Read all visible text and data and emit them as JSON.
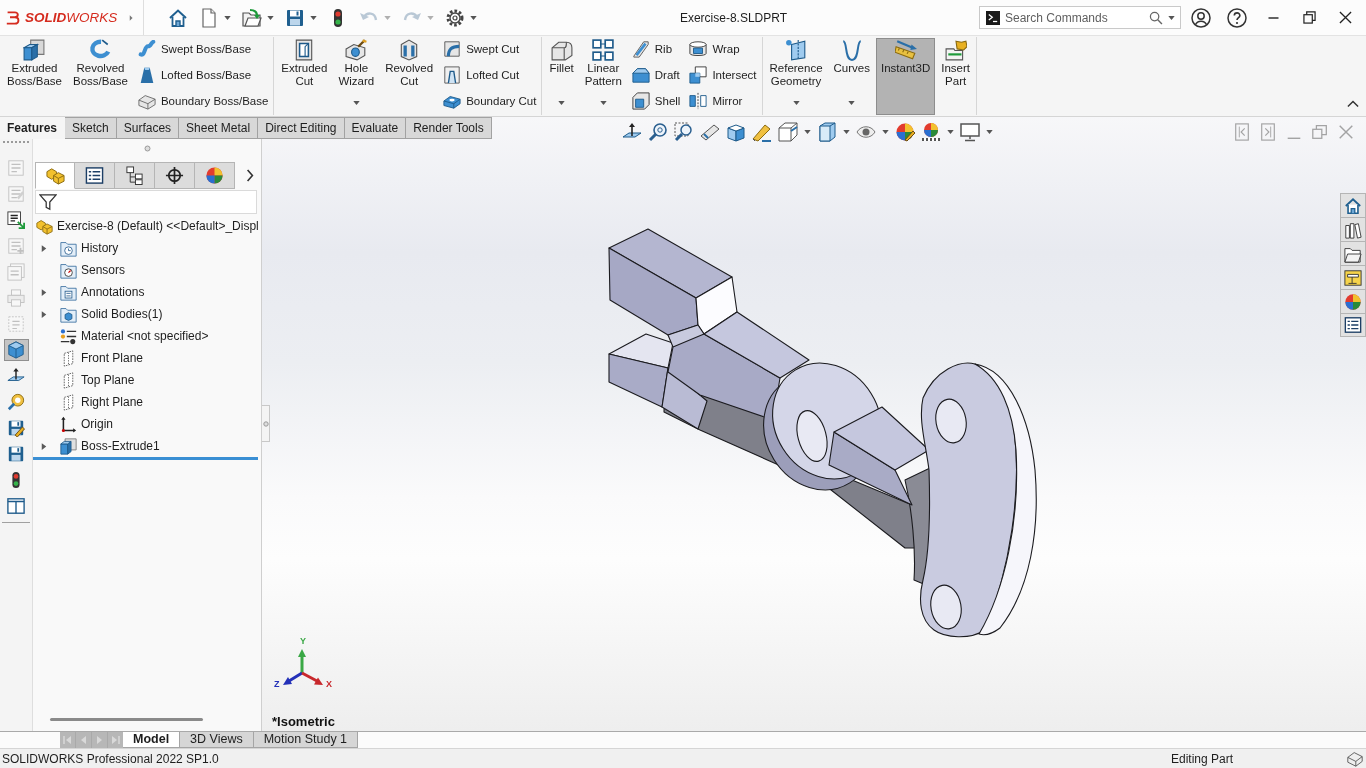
{
  "title_bar": {
    "logo": "**SOLID**WORKS",
    "title": "Exercise-8.SLDPRT",
    "search": {
      "placeholder": "Search Commands"
    }
  },
  "quick_access": [
    {
      "disabled": false,
      "dropdown": false
    },
    {
      "disabled": false,
      "dropdown": true
    },
    {
      "disabled": false,
      "dropdown": true
    },
    {
      "disabled": false,
      "dropdown": true
    },
    {
      "disabled": false,
      "dropdown": false
    },
    {
      "disabled": true,
      "dropdown": true
    },
    {
      "disabled": true,
      "dropdown": true
    },
    {
      "disabled": false,
      "dropdown": true
    }
  ],
  "ribbon": {
    "groups": [
      {
        "columns": [
          {
            "kind": "large",
            "label": "Extruded Boss/Base",
            "dropdown": false,
            "pressed": false
          },
          {
            "kind": "large",
            "label": "Revolved Boss/Base",
            "dropdown": false,
            "pressed": false
          },
          {
            "kind": "small",
            "items": [
              {
                "label": "Swept Boss/Base",
                "pressed": false
              },
              {
                "label": "Lofted Boss/Base",
                "pressed": false
              },
              {
                "label": "Boundary Boss/Base",
                "pressed": false
              }
            ]
          }
        ]
      },
      {
        "columns": [
          {
            "kind": "large",
            "label": "Extruded Cut",
            "dropdown": false,
            "pressed": false
          },
          {
            "kind": "large",
            "label": "Hole Wizard",
            "dropdown": true,
            "pressed": false
          },
          {
            "kind": "large",
            "label": "Revolved Cut",
            "dropdown": false,
            "pressed": false
          },
          {
            "kind": "small",
            "items": [
              {
                "label": "Swept Cut",
                "pressed": false
              },
              {
                "label": "Lofted Cut",
                "pressed": false
              },
              {
                "label": "Boundary Cut",
                "pressed": false
              }
            ]
          }
        ]
      },
      {
        "columns": [
          {
            "kind": "large",
            "label": "Fillet",
            "dropdown": true,
            "pressed": false
          },
          {
            "kind": "large",
            "label": "Linear Pattern",
            "dropdown": true,
            "pressed": false
          },
          {
            "kind": "small",
            "items": [
              {
                "label": "Rib",
                "pressed": false
              },
              {
                "label": "Draft",
                "pressed": false
              },
              {
                "label": "Shell",
                "pressed": false
              }
            ]
          },
          {
            "kind": "small",
            "items": [
              {
                "label": "Wrap",
                "pressed": false
              },
              {
                "label": "Intersect",
                "pressed": false
              },
              {
                "label": "Mirror",
                "pressed": false
              }
            ]
          }
        ]
      },
      {
        "columns": [
          {
            "kind": "large",
            "label": "Reference Geometry",
            "dropdown": true,
            "pressed": false
          },
          {
            "kind": "large",
            "label": "Curves",
            "dropdown": true,
            "pressed": false
          },
          {
            "kind": "large",
            "label": "Instant3D",
            "dropdown": false,
            "pressed": true
          },
          {
            "kind": "large",
            "label": "Insert Part",
            "dropdown": false,
            "pressed": false
          }
        ]
      }
    ]
  },
  "command_tabs": [
    {
      "label": "Features",
      "selected": true
    },
    {
      "label": "Sketch",
      "selected": false
    },
    {
      "label": "Surfaces",
      "selected": false
    },
    {
      "label": "Sheet Metal",
      "selected": false
    },
    {
      "label": "Direct Editing",
      "selected": false
    },
    {
      "label": "Evaluate",
      "selected": false
    },
    {
      "label": "Render Tools",
      "selected": false
    }
  ],
  "left_toolbar": [
    {
      "disabled": true,
      "selected": false
    },
    {
      "disabled": true,
      "selected": false
    },
    {
      "disabled": false,
      "selected": false
    },
    {
      "disabled": true,
      "selected": false
    },
    {
      "disabled": true,
      "selected": false
    },
    {
      "disabled": true,
      "selected": false
    },
    {
      "disabled": true,
      "selected": false
    },
    {
      "disabled": false,
      "selected": true
    },
    {
      "disabled": false,
      "selected": false
    },
    {
      "disabled": false,
      "selected": false
    },
    {
      "disabled": false,
      "selected": false
    },
    {
      "disabled": false,
      "selected": false
    },
    {
      "disabled": false,
      "selected": false
    },
    {
      "disabled": false,
      "selected": false
    }
  ],
  "feature_manager": {
    "tabs": [
      {
        "selected": true
      },
      {
        "selected": false
      },
      {
        "selected": false
      },
      {
        "selected": false
      },
      {
        "selected": false
      }
    ],
    "tree": {
      "label": "Exercise-8 (Default) <<Default>_Displ",
      "kind": "part",
      "children": [
        {
          "label": "History",
          "kind": "history",
          "expanded": false
        },
        {
          "label": "Sensors",
          "kind": "sensors"
        },
        {
          "label": "Annotations",
          "kind": "annotations",
          "expanded": false
        },
        {
          "label": "Solid Bodies(1)",
          "kind": "bodies",
          "expanded": false
        },
        {
          "label": "Material <not specified>",
          "kind": "material"
        },
        {
          "label": "Front Plane",
          "kind": "plane"
        },
        {
          "label": "Top Plane",
          "kind": "plane"
        },
        {
          "label": "Right Plane",
          "kind": "plane"
        },
        {
          "label": "Origin",
          "kind": "origin"
        },
        {
          "label": "Boss-Extrude1",
          "kind": "extrude",
          "expanded": false
        }
      ]
    }
  },
  "viewport": {
    "view_name": "*Isometric",
    "triad": [
      {
        "label": "Y",
        "color": "#3aa845"
      },
      {
        "label": "Z",
        "color": "#2330b8"
      },
      {
        "label": "X",
        "color": "#c8282c"
      }
    ]
  },
  "model_tabs": [
    {
      "label": "Model",
      "selected": true
    },
    {
      "label": "3D Views",
      "selected": false
    },
    {
      "label": "Motion Study 1",
      "selected": false
    }
  ],
  "status_bar": {
    "product": "SOLIDWORKS Professional 2022 SP1.0",
    "mode": "Editing Part"
  }
}
